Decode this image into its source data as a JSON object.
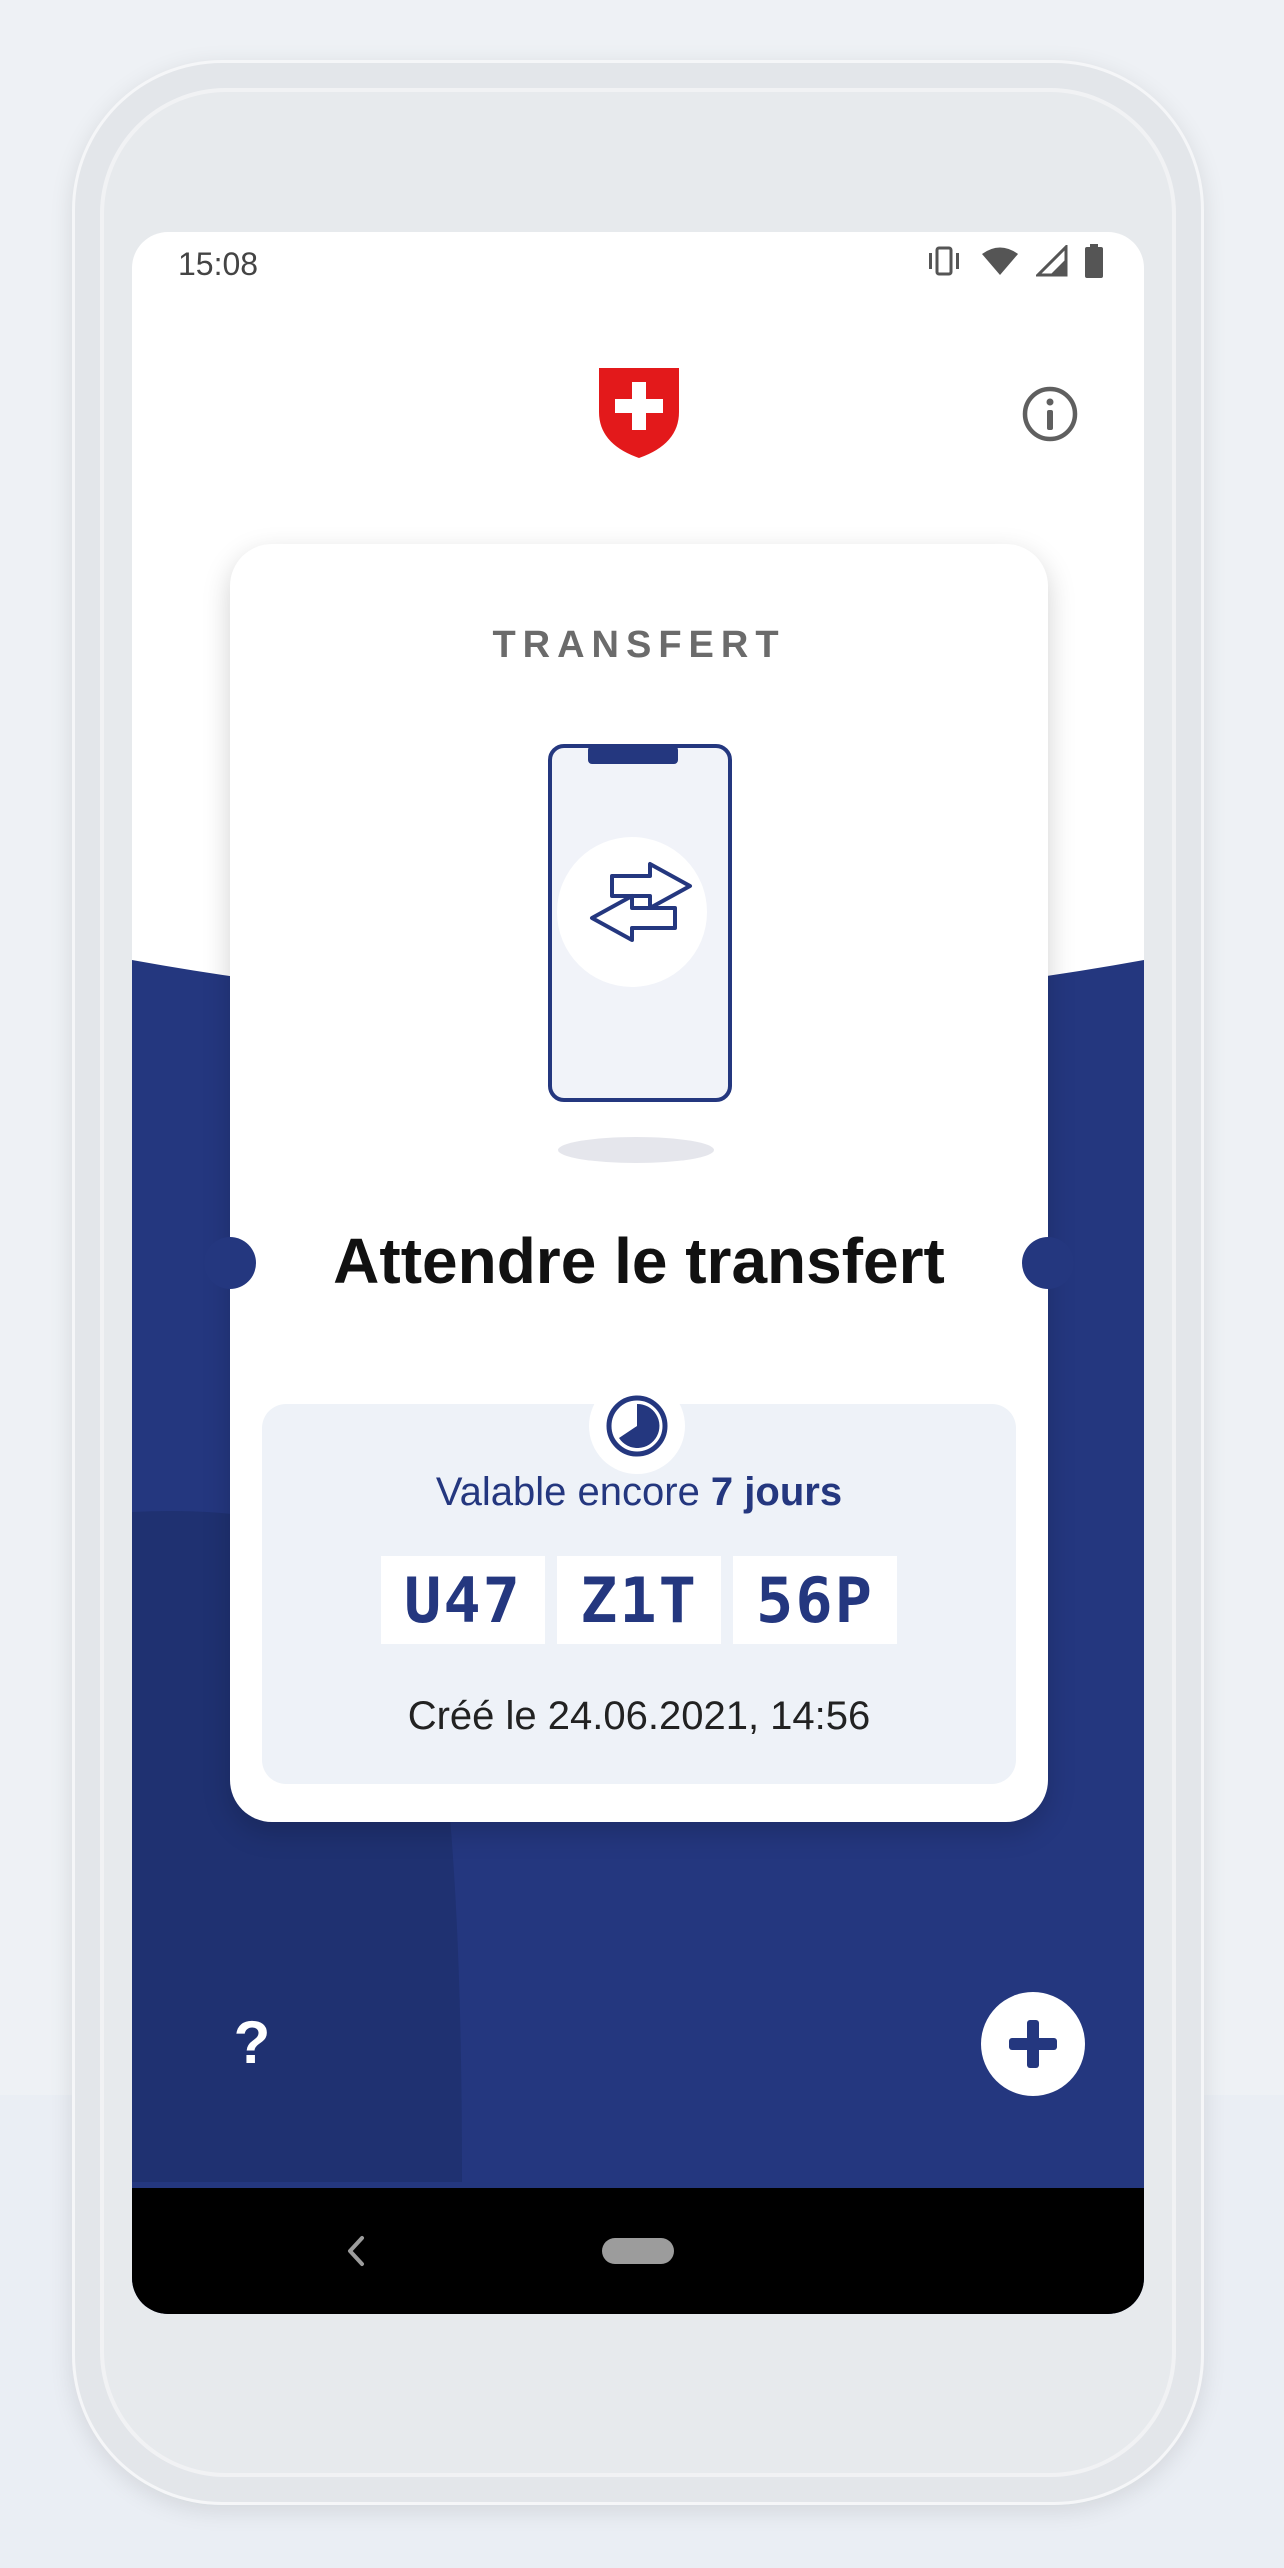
{
  "status_bar": {
    "time": "15:08"
  },
  "card": {
    "label": "TRANSFERT",
    "title": "Attendre le transfert",
    "validity_prefix": "Valable encore ",
    "validity_value": "7 jours",
    "codes": [
      "U47",
      "Z1T",
      "56P"
    ],
    "created": "Créé le 24.06.2021, 14:56"
  },
  "buttons": {
    "help": "?"
  },
  "icons": {
    "app_logo": "swiss-cross-shield-icon",
    "info": "info-icon",
    "illustration": "phone-transfer-arrows-icon",
    "timer": "timer-icon",
    "add": "plus-icon",
    "back": "back-chevron-icon"
  },
  "colors": {
    "brand_blue": "#24377f",
    "swiss_red": "#e3191b",
    "background": "#ffffff"
  }
}
